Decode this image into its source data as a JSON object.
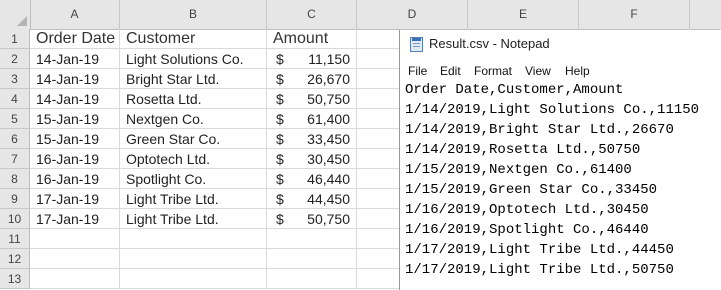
{
  "spreadsheet": {
    "columns": [
      "A",
      "B",
      "C",
      "D",
      "E",
      "F"
    ],
    "rows": [
      "1",
      "2",
      "3",
      "4",
      "5",
      "6",
      "7",
      "8",
      "9",
      "10",
      "11",
      "12",
      "13"
    ],
    "header": {
      "order_date": "Order Date",
      "customer": "Customer",
      "amount": "Amount"
    },
    "currency_symbol": "$",
    "data": [
      {
        "date": "14-Jan-19",
        "customer": "Light Solutions Co.",
        "amount": "11,150"
      },
      {
        "date": "14-Jan-19",
        "customer": "Bright Star Ltd.",
        "amount": "26,670"
      },
      {
        "date": "14-Jan-19",
        "customer": "Rosetta Ltd.",
        "amount": "50,750"
      },
      {
        "date": "15-Jan-19",
        "customer": "Nextgen Co.",
        "amount": "61,400"
      },
      {
        "date": "15-Jan-19",
        "customer": "Green Star Co.",
        "amount": "33,450"
      },
      {
        "date": "16-Jan-19",
        "customer": "Optotech Ltd.",
        "amount": "30,450"
      },
      {
        "date": "16-Jan-19",
        "customer": "Spotlight Co.",
        "amount": "46,440"
      },
      {
        "date": "17-Jan-19",
        "customer": "Light Tribe Ltd.",
        "amount": "44,450"
      },
      {
        "date": "17-Jan-19",
        "customer": "Light Tribe Ltd.",
        "amount": "50,750"
      }
    ]
  },
  "notepad": {
    "title": "Result.csv - Notepad",
    "menu": [
      "File",
      "Edit",
      "Format",
      "View",
      "Help"
    ],
    "lines": [
      "Order Date,Customer,Amount",
      "1/14/2019,Light Solutions Co.,11150",
      "1/14/2019,Bright Star Ltd.,26670",
      "1/14/2019,Rosetta Ltd.,50750",
      "1/15/2019,Nextgen Co.,61400",
      "1/15/2019,Green Star Co.,33450",
      "1/16/2019,Optotech Ltd.,30450",
      "1/16/2019,Spotlight Co.,46440",
      "1/17/2019,Light Tribe Ltd.,44450",
      "1/17/2019,Light Tribe Ltd.,50750"
    ]
  }
}
